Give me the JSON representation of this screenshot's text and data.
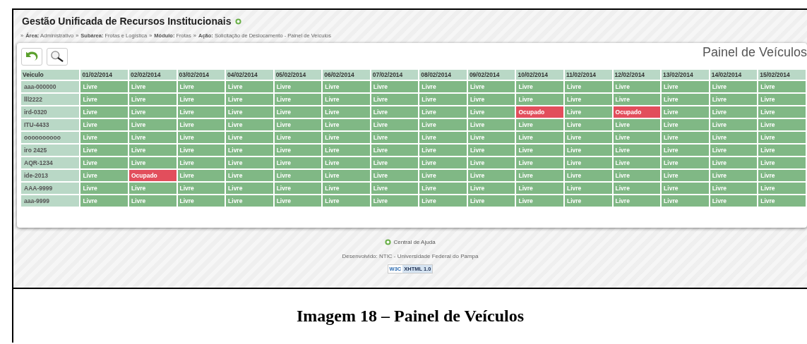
{
  "app_title": "Gestão Unificada de Recursos Institucionais",
  "breadcrumb": [
    {
      "separator": "»",
      "label": "Área:",
      "value": "Administrativo"
    },
    {
      "separator": "»",
      "label": "Subárea:",
      "value": "Frotas e Logística"
    },
    {
      "separator": "»",
      "label": "Módulo:",
      "value": "Frotas"
    },
    {
      "separator": "»",
      "label": "Ação:",
      "value": "Solicitação de Deslocamento - Painel de Veículos"
    }
  ],
  "panel_title": "Painel de Veículos",
  "table": {
    "columns": [
      "Veiculo",
      "01/02/2014",
      "02/02/2014",
      "03/02/2014",
      "04/02/2014",
      "05/02/2014",
      "06/02/2014",
      "07/02/2014",
      "08/02/2014",
      "09/02/2014",
      "10/02/2014",
      "11/02/2014",
      "12/02/2014",
      "13/02/2014",
      "14/02/2014",
      "15/02/2014"
    ],
    "rows": [
      {
        "cells": [
          {
            "text": "aaa-000000",
            "kind": "vehicle"
          },
          {
            "text": "Livre",
            "kind": "free"
          },
          {
            "text": "Livre",
            "kind": "free"
          },
          {
            "text": "Livre",
            "kind": "free"
          },
          {
            "text": "Livre",
            "kind": "free"
          },
          {
            "text": "Livre",
            "kind": "free"
          },
          {
            "text": "Livre",
            "kind": "free"
          },
          {
            "text": "Livre",
            "kind": "free"
          },
          {
            "text": "Livre",
            "kind": "free"
          },
          {
            "text": "Livre",
            "kind": "free"
          },
          {
            "text": "Livre",
            "kind": "free"
          },
          {
            "text": "Livre",
            "kind": "free"
          },
          {
            "text": "Livre",
            "kind": "free"
          },
          {
            "text": "Livre",
            "kind": "free"
          },
          {
            "text": "Livre",
            "kind": "free"
          },
          {
            "text": "Livre",
            "kind": "free"
          }
        ]
      },
      {
        "cells": [
          {
            "text": "lll2222",
            "kind": "vehicle"
          },
          {
            "text": "Livre",
            "kind": "free"
          },
          {
            "text": "Livre",
            "kind": "free"
          },
          {
            "text": "Livre",
            "kind": "free"
          },
          {
            "text": "Livre",
            "kind": "free"
          },
          {
            "text": "Livre",
            "kind": "free"
          },
          {
            "text": "Livre",
            "kind": "free"
          },
          {
            "text": "Livre",
            "kind": "free"
          },
          {
            "text": "Livre",
            "kind": "free"
          },
          {
            "text": "Livre",
            "kind": "free"
          },
          {
            "text": "Livre",
            "kind": "free"
          },
          {
            "text": "Livre",
            "kind": "free"
          },
          {
            "text": "Livre",
            "kind": "free"
          },
          {
            "text": "Livre",
            "kind": "free"
          },
          {
            "text": "Livre",
            "kind": "free"
          },
          {
            "text": "Livre",
            "kind": "free"
          }
        ]
      },
      {
        "cells": [
          {
            "text": "ird-0320",
            "kind": "vehicle"
          },
          {
            "text": "Livre",
            "kind": "free"
          },
          {
            "text": "Livre",
            "kind": "free"
          },
          {
            "text": "Livre",
            "kind": "free"
          },
          {
            "text": "Livre",
            "kind": "free"
          },
          {
            "text": "Livre",
            "kind": "free"
          },
          {
            "text": "Livre",
            "kind": "free"
          },
          {
            "text": "Livre",
            "kind": "free"
          },
          {
            "text": "Livre",
            "kind": "free"
          },
          {
            "text": "Livre",
            "kind": "free"
          },
          {
            "text": "Ocupado",
            "kind": "occupied"
          },
          {
            "text": "Livre",
            "kind": "free"
          },
          {
            "text": "Ocupado",
            "kind": "occupied"
          },
          {
            "text": "Livre",
            "kind": "free"
          },
          {
            "text": "Livre",
            "kind": "free"
          },
          {
            "text": "Livre",
            "kind": "free"
          }
        ]
      },
      {
        "cells": [
          {
            "text": "ITU-4433",
            "kind": "vehicle"
          },
          {
            "text": "Livre",
            "kind": "free"
          },
          {
            "text": "Livre",
            "kind": "free"
          },
          {
            "text": "Livre",
            "kind": "free"
          },
          {
            "text": "Livre",
            "kind": "free"
          },
          {
            "text": "Livre",
            "kind": "free"
          },
          {
            "text": "Livre",
            "kind": "free"
          },
          {
            "text": "Livre",
            "kind": "free"
          },
          {
            "text": "Livre",
            "kind": "free"
          },
          {
            "text": "Livre",
            "kind": "free"
          },
          {
            "text": "Livre",
            "kind": "free"
          },
          {
            "text": "Livre",
            "kind": "free"
          },
          {
            "text": "Livre",
            "kind": "free"
          },
          {
            "text": "Livre",
            "kind": "free"
          },
          {
            "text": "Livre",
            "kind": "free"
          },
          {
            "text": "Livre",
            "kind": "free"
          }
        ]
      },
      {
        "cells": [
          {
            "text": "oooooooooo",
            "kind": "vehicle"
          },
          {
            "text": "Livre",
            "kind": "free"
          },
          {
            "text": "Livre",
            "kind": "free"
          },
          {
            "text": "Livre",
            "kind": "free"
          },
          {
            "text": "Livre",
            "kind": "free"
          },
          {
            "text": "Livre",
            "kind": "free"
          },
          {
            "text": "Livre",
            "kind": "free"
          },
          {
            "text": "Livre",
            "kind": "free"
          },
          {
            "text": "Livre",
            "kind": "free"
          },
          {
            "text": "Livre",
            "kind": "free"
          },
          {
            "text": "Livre",
            "kind": "free"
          },
          {
            "text": "Livre",
            "kind": "free"
          },
          {
            "text": "Livre",
            "kind": "free"
          },
          {
            "text": "Livre",
            "kind": "free"
          },
          {
            "text": "Livre",
            "kind": "free"
          },
          {
            "text": "Livre",
            "kind": "free"
          }
        ]
      },
      {
        "cells": [
          {
            "text": "iro 2425",
            "kind": "vehicle"
          },
          {
            "text": "Livre",
            "kind": "free"
          },
          {
            "text": "Livre",
            "kind": "free"
          },
          {
            "text": "Livre",
            "kind": "free"
          },
          {
            "text": "Livre",
            "kind": "free"
          },
          {
            "text": "Livre",
            "kind": "free"
          },
          {
            "text": "Livre",
            "kind": "free"
          },
          {
            "text": "Livre",
            "kind": "free"
          },
          {
            "text": "Livre",
            "kind": "free"
          },
          {
            "text": "Livre",
            "kind": "free"
          },
          {
            "text": "Livre",
            "kind": "free"
          },
          {
            "text": "Livre",
            "kind": "free"
          },
          {
            "text": "Livre",
            "kind": "free"
          },
          {
            "text": "Livre",
            "kind": "free"
          },
          {
            "text": "Livre",
            "kind": "free"
          },
          {
            "text": "Livre",
            "kind": "free"
          }
        ]
      },
      {
        "cells": [
          {
            "text": "AQR-1234",
            "kind": "vehicle"
          },
          {
            "text": "Livre",
            "kind": "free"
          },
          {
            "text": "Livre",
            "kind": "free"
          },
          {
            "text": "Livre",
            "kind": "free"
          },
          {
            "text": "Livre",
            "kind": "free"
          },
          {
            "text": "Livre",
            "kind": "free"
          },
          {
            "text": "Livre",
            "kind": "free"
          },
          {
            "text": "Livre",
            "kind": "free"
          },
          {
            "text": "Livre",
            "kind": "free"
          },
          {
            "text": "Livre",
            "kind": "free"
          },
          {
            "text": "Livre",
            "kind": "free"
          },
          {
            "text": "Livre",
            "kind": "free"
          },
          {
            "text": "Livre",
            "kind": "free"
          },
          {
            "text": "Livre",
            "kind": "free"
          },
          {
            "text": "Livre",
            "kind": "free"
          },
          {
            "text": "Livre",
            "kind": "free"
          }
        ]
      },
      {
        "cells": [
          {
            "text": "ide-2013",
            "kind": "vehicle"
          },
          {
            "text": "Livre",
            "kind": "free"
          },
          {
            "text": "Ocupado",
            "kind": "occupied"
          },
          {
            "text": "Livre",
            "kind": "free"
          },
          {
            "text": "Livre",
            "kind": "free"
          },
          {
            "text": "Livre",
            "kind": "free"
          },
          {
            "text": "Livre",
            "kind": "free"
          },
          {
            "text": "Livre",
            "kind": "free"
          },
          {
            "text": "Livre",
            "kind": "free"
          },
          {
            "text": "Livre",
            "kind": "free"
          },
          {
            "text": "Livre",
            "kind": "free"
          },
          {
            "text": "Livre",
            "kind": "free"
          },
          {
            "text": "Livre",
            "kind": "free"
          },
          {
            "text": "Livre",
            "kind": "free"
          },
          {
            "text": "Livre",
            "kind": "free"
          },
          {
            "text": "Livre",
            "kind": "free"
          }
        ]
      },
      {
        "cells": [
          {
            "text": "AAA-9999",
            "kind": "vehicle"
          },
          {
            "text": "Livre",
            "kind": "free"
          },
          {
            "text": "Livre",
            "kind": "free"
          },
          {
            "text": "Livre",
            "kind": "free"
          },
          {
            "text": "Livre",
            "kind": "free"
          },
          {
            "text": "Livre",
            "kind": "free"
          },
          {
            "text": "Livre",
            "kind": "free"
          },
          {
            "text": "Livre",
            "kind": "free"
          },
          {
            "text": "Livre",
            "kind": "free"
          },
          {
            "text": "Livre",
            "kind": "free"
          },
          {
            "text": "Livre",
            "kind": "free"
          },
          {
            "text": "Livre",
            "kind": "free"
          },
          {
            "text": "Livre",
            "kind": "free"
          },
          {
            "text": "Livre",
            "kind": "free"
          },
          {
            "text": "Livre",
            "kind": "free"
          },
          {
            "text": "Livre",
            "kind": "free"
          }
        ]
      },
      {
        "cells": [
          {
            "text": "aaa-9999",
            "kind": "vehicle"
          },
          {
            "text": "Livre",
            "kind": "free"
          },
          {
            "text": "Livre",
            "kind": "free"
          },
          {
            "text": "Livre",
            "kind": "free"
          },
          {
            "text": "Livre",
            "kind": "free"
          },
          {
            "text": "Livre",
            "kind": "free"
          },
          {
            "text": "Livre",
            "kind": "free"
          },
          {
            "text": "Livre",
            "kind": "free"
          },
          {
            "text": "Livre",
            "kind": "free"
          },
          {
            "text": "Livre",
            "kind": "free"
          },
          {
            "text": "Livre",
            "kind": "free"
          },
          {
            "text": "Livre",
            "kind": "free"
          },
          {
            "text": "Livre",
            "kind": "free"
          },
          {
            "text": "Livre",
            "kind": "free"
          },
          {
            "text": "Livre",
            "kind": "free"
          },
          {
            "text": "Livre",
            "kind": "free"
          }
        ]
      }
    ]
  },
  "footer": {
    "help_link": "Central de Ajuda",
    "credit": "Desenvolvido: NTIC - Universidade Federal do Pampa",
    "badge": {
      "left": "W3C",
      "right": "XHTML 1.0"
    }
  },
  "caption": "Imagem 18 – Painel de Veículos"
}
